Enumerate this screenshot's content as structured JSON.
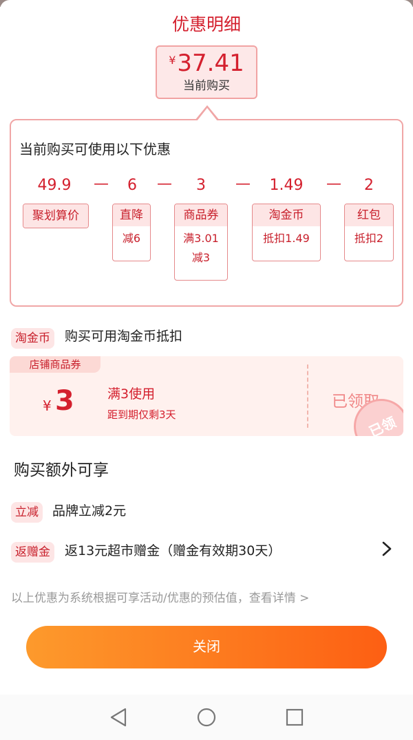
{
  "title": "优惠明细",
  "price": {
    "currency": "¥",
    "amount": "37.41",
    "label": "当前购买"
  },
  "breakdown": {
    "title": "当前购买可使用以下优惠",
    "minus": "—",
    "items": [
      {
        "value": "49.9",
        "label": "聚划算价",
        "detail": []
      },
      {
        "value": "6",
        "label": "直降",
        "detail": [
          "减6"
        ]
      },
      {
        "value": "3",
        "label": "商品券",
        "detail": [
          "满3.01",
          "减3"
        ]
      },
      {
        "value": "1.49",
        "label": "淘金币",
        "detail": [
          "抵扣1.49"
        ]
      },
      {
        "value": "2",
        "label": "红包",
        "detail": [
          "抵扣2"
        ]
      }
    ]
  },
  "taojinbi": {
    "tag": "淘金币",
    "text": "购买可用淘金币抵扣"
  },
  "coupon": {
    "tag": "店铺商品券",
    "currency": "¥",
    "value": "3",
    "condition": "满3使用",
    "expiry": "距到期仅剩3天",
    "status": "已领取",
    "stamp": "已领"
  },
  "extra": {
    "title": "购买额外可享",
    "items": [
      {
        "tag": "立减",
        "text": "品牌立减2元"
      },
      {
        "tag": "返赠金",
        "text": "返13元超市赠金（赠金有效期30天）"
      }
    ]
  },
  "disclaimer": "以上优惠为系统根据可享活动/优惠的预估值，查看详情 >",
  "close_label": "关闭",
  "nav": {
    "back": "back-icon",
    "home": "home-icon",
    "recents": "recents-icon"
  }
}
